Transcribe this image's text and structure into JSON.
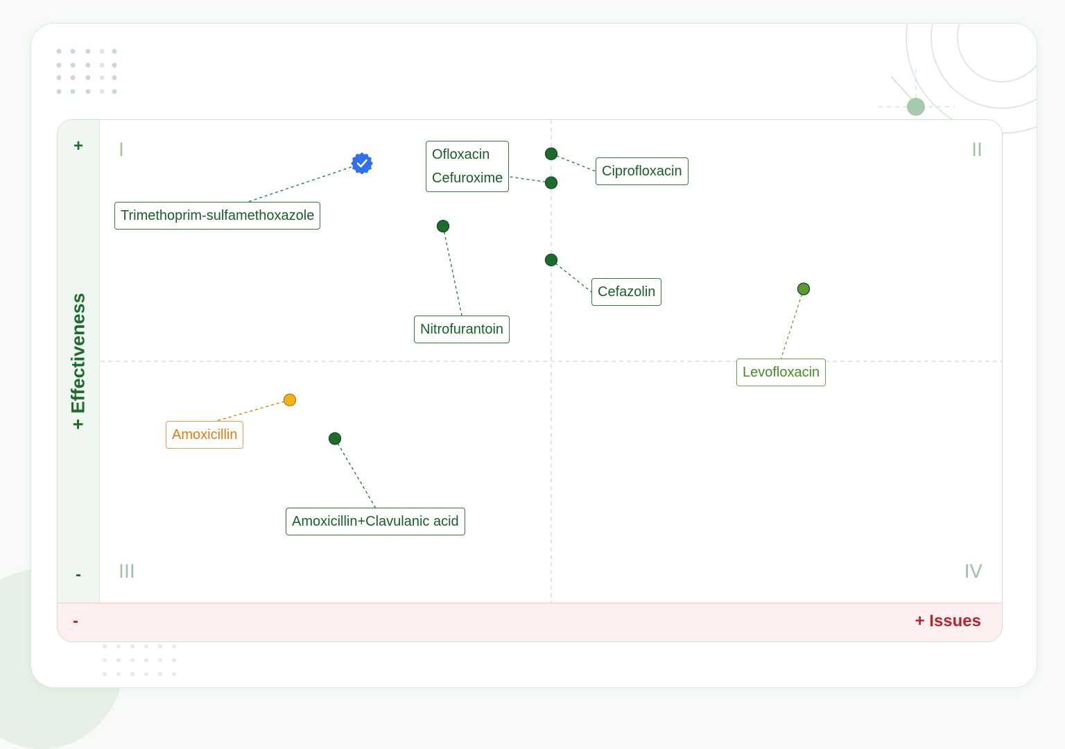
{
  "colors": {
    "dark_green": "#1e6b2e",
    "light_green": "#5a9a2f",
    "orange": "#e08a1e",
    "amber": "#f2b21b",
    "blue": "#2f6ff0",
    "red": "#b3262c"
  },
  "chart_data": {
    "type": "scatter",
    "title": "",
    "xlabel": "+ Issues",
    "ylabel": "+ Effectiveness",
    "x_low_label": "-",
    "y_high_label": "+",
    "y_low_label": "-",
    "xlim": [
      0,
      10
    ],
    "ylim": [
      0,
      10
    ],
    "grid": false,
    "quadrants": {
      "q1": "I",
      "q2": "II",
      "q3": "III",
      "q4": "IV"
    },
    "points": [
      {
        "labels": [
          "Trimethoprim-sulfamethoxazole"
        ],
        "x": 2.9,
        "y": 9.1,
        "color": "#2f6ff0",
        "marker": "verified-badge"
      },
      {
        "labels": [
          "Ofloxacin",
          "Cefuroxime"
        ],
        "x": 5.0,
        "y": 8.7,
        "color": "#1e6b2e",
        "marker": "dot"
      },
      {
        "labels": [
          "Ciprofloxacin"
        ],
        "x": 5.0,
        "y": 9.3,
        "color": "#1e6b2e",
        "marker": "dot"
      },
      {
        "labels": [
          "Nitrofurantoin"
        ],
        "x": 3.8,
        "y": 7.8,
        "color": "#1e6b2e",
        "marker": "dot"
      },
      {
        "labels": [
          "Cefazolin"
        ],
        "x": 5.0,
        "y": 7.1,
        "color": "#1e6b2e",
        "marker": "dot"
      },
      {
        "labels": [
          "Levofloxacin"
        ],
        "x": 7.8,
        "y": 6.5,
        "color": "#5a9a2f",
        "marker": "dot"
      },
      {
        "labels": [
          "Amoxicillin"
        ],
        "x": 2.1,
        "y": 4.2,
        "color": "#f2b21b",
        "marker": "dot"
      },
      {
        "labels": [
          "Amoxicillin+Clavulanic acid"
        ],
        "x": 2.6,
        "y": 3.4,
        "color": "#1e6b2e",
        "marker": "dot"
      }
    ]
  }
}
